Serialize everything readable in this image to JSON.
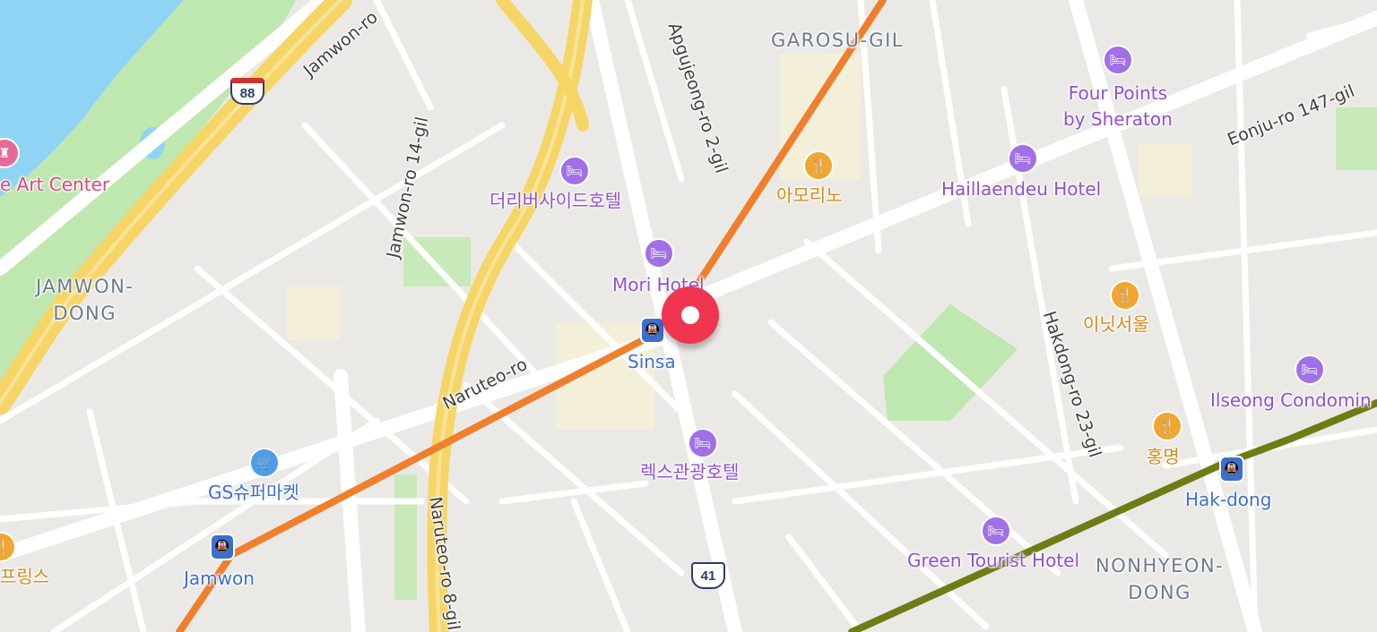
{
  "map": {
    "pin": {
      "name": "selected-location-pin",
      "color": "#f0364f"
    },
    "colors": {
      "background": "#ebe9e5",
      "river": "#8fd4f5",
      "park": "#bfe7b0",
      "expressway": "#f6d567",
      "subway_line_3": "#ef7f2d",
      "subway_line_7": "#6e7c14",
      "hotel": "#8f4fd3",
      "restaurant": "#d48a17",
      "station": "#3d6fd0"
    },
    "areas": {
      "garosu": "GAROSU-GIL",
      "jamwon": "JAMWON-\nDONG",
      "nonhyeon": "NONHYEON-\nDONG"
    },
    "roads": {
      "jamwon_ro": "Jamwon-ro",
      "jamwon_ro_14": "Jamwon-ro 14-gil",
      "apgujeong_2": "Apgujeong-ro 2-gil",
      "naruteo": "Naruteo-ro",
      "naruteo_8": "Naruteo-ro 8-gil",
      "hakdong_23": "Hakdong-ro 23-gil",
      "eonju_147": "Eonju-ro 147-gil"
    },
    "shields": {
      "route_88": "88",
      "route_41": "41"
    },
    "pois": {
      "art_center": "e Art Center",
      "the_riverside": "더리버사이드호텔",
      "mori_hotel": "Mori Hotel",
      "amorino": "아모리노",
      "four_points": "Four Points\nby Sheraton",
      "haillaendeu": "Haillaendeu Hotel",
      "initseoul": "이닛서울",
      "ilseong": "Ilseong Condomin",
      "hongmyeong": "홍명",
      "rex_hotel": "렉스관광호텔",
      "gs_super": "GS슈퍼마켓",
      "green_tourist": "Green Tourist Hotel",
      "springs": "프링스"
    },
    "stations": {
      "sinsa": "Sinsa",
      "jamwon": "Jamwon",
      "hakdong": "Hak-dong"
    }
  }
}
